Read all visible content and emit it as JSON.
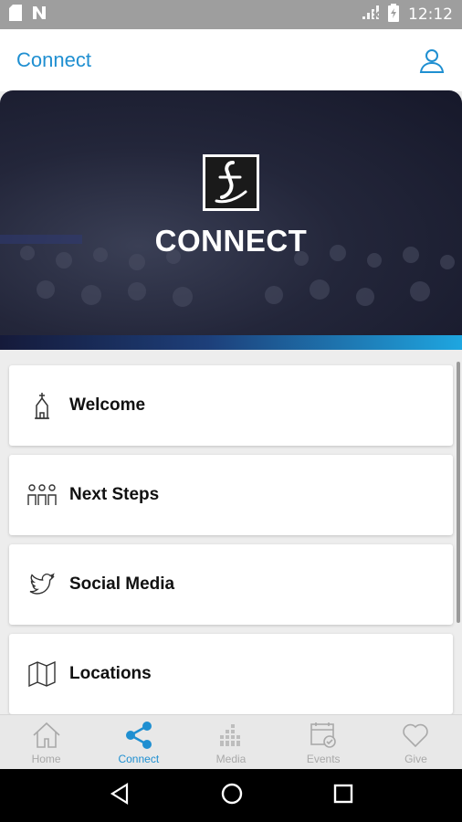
{
  "status_bar": {
    "time": "12:12"
  },
  "app_bar": {
    "title": "Connect",
    "profile_icon": "user-icon"
  },
  "hero": {
    "title": "CONNECT",
    "logo_icon": "church-logo-icon"
  },
  "menu_items": [
    {
      "label": "Welcome",
      "icon": "church-icon"
    },
    {
      "label": "Next Steps",
      "icon": "people-icon"
    },
    {
      "label": "Social Media",
      "icon": "twitter-icon"
    },
    {
      "label": "Locations",
      "icon": "map-icon"
    }
  ],
  "bottom_nav": [
    {
      "label": "Home",
      "icon": "home-icon",
      "active": false
    },
    {
      "label": "Connect",
      "icon": "share-icon",
      "active": true
    },
    {
      "label": "Media",
      "icon": "media-icon",
      "active": false
    },
    {
      "label": "Events",
      "icon": "calendar-icon",
      "active": false
    },
    {
      "label": "Give",
      "icon": "heart-icon",
      "active": false
    }
  ],
  "colors": {
    "accent": "#1f8fd1",
    "status_bar": "#9e9e9e",
    "inactive_nav": "#a9a9a9"
  }
}
